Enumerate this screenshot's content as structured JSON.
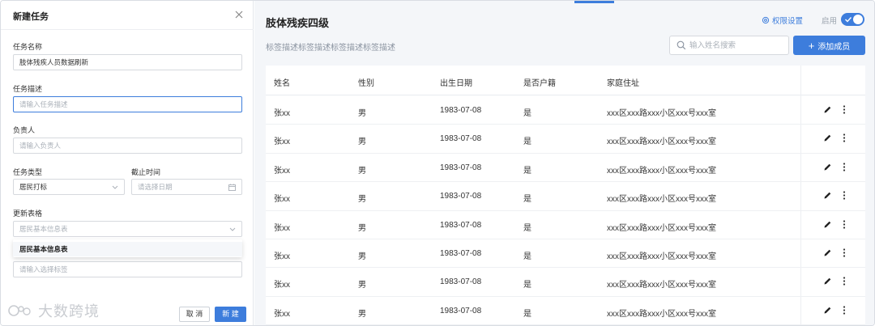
{
  "dialog": {
    "title": "新建任务",
    "fields": {
      "task_name": {
        "label": "任务名称",
        "value": "肢体残疾人员数据刷新"
      },
      "task_desc": {
        "label": "任务描述",
        "placeholder": "请输入任务描述"
      },
      "owner": {
        "label": "负责人",
        "placeholder": "请输入负责人"
      },
      "task_type": {
        "label": "任务类型",
        "value": "居民打标"
      },
      "deadline": {
        "label": "截止时间",
        "placeholder": "请选择日期"
      },
      "update_table": {
        "label": "更新表格",
        "placeholder": "居民基本信息表"
      },
      "tags": {
        "placeholder": "请输入选择标签"
      }
    },
    "dropdown_options": [
      "居民基本信息表"
    ],
    "cancel_label": "取 消",
    "create_label": "新 建"
  },
  "watermark": {
    "text": "大数跨境"
  },
  "main": {
    "title": "肢体残疾四级",
    "description": "标签描述标签描述标签描述标签描述",
    "permission_label": "权限设置",
    "enable_label": "启用",
    "enabled": true,
    "search_placeholder": "输入姓名搜索",
    "add_member_label": "添加成员",
    "columns": [
      "姓名",
      "性别",
      "出生日期",
      "是否户籍",
      "家庭住址"
    ],
    "rows": [
      [
        "张xx",
        "男",
        "1983-07-08",
        "是",
        "xxx区xxx路xxx小区xxx号xxx室"
      ],
      [
        "张xx",
        "男",
        "1983-07-08",
        "是",
        "xxx区xxx路xxx小区xxx号xxx室"
      ],
      [
        "张xx",
        "男",
        "1983-07-08",
        "是",
        "xxx区xxx路xxx小区xxx号xxx室"
      ],
      [
        "张xx",
        "男",
        "1983-07-08",
        "是",
        "xxx区xxx路xxx小区xxx号xxx室"
      ],
      [
        "张xx",
        "男",
        "1983-07-08",
        "是",
        "xxx区xxx路xxx小区xxx号xxx室"
      ],
      [
        "张xx",
        "男",
        "1983-07-08",
        "是",
        "xxx区xxx路xxx小区xxx号xxx室"
      ],
      [
        "张xx",
        "男",
        "1983-07-08",
        "是",
        "xxx区xxx路xxx小区xxx号xxx室"
      ],
      [
        "张xx",
        "男",
        "1983-07-08",
        "是",
        "xxx区xxx路xxx小区xxx号xxx室"
      ]
    ]
  },
  "colors": {
    "accent": "#3d7ddc",
    "panel_bg": "#f4f6f9"
  }
}
